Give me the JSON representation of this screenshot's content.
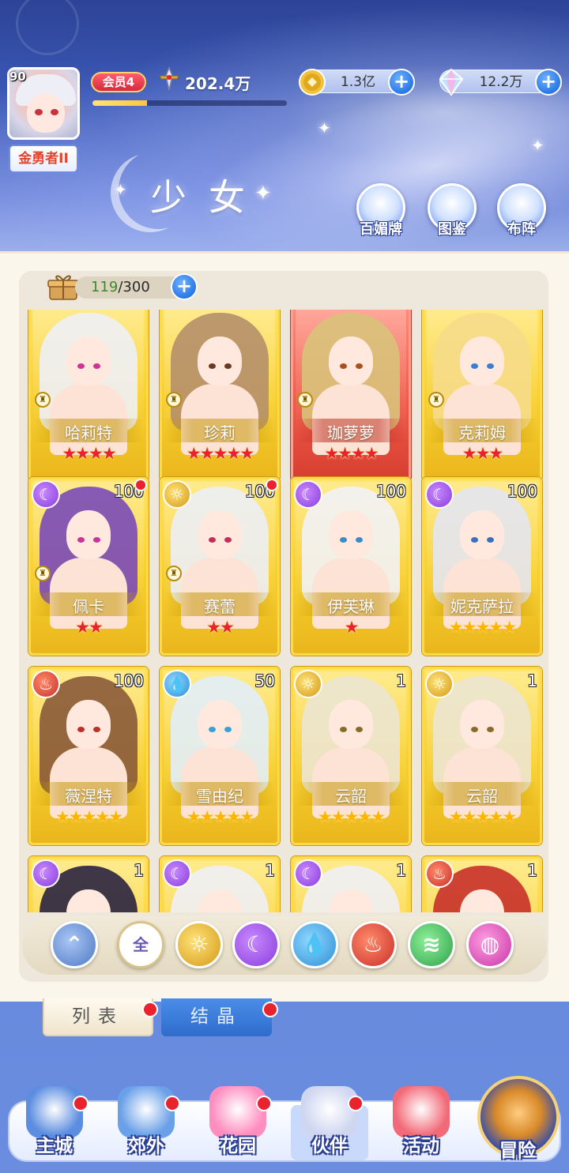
{
  "player": {
    "level": "90",
    "title": "金勇者II",
    "vip": "会员4",
    "power": "202.4万",
    "exp_progress": 0.28
  },
  "currencies": [
    {
      "name": "gold",
      "value": "1.3亿"
    },
    {
      "name": "crystal",
      "value": "12.2万"
    }
  ],
  "page_title": "少女",
  "top_buttons": [
    {
      "label": "百媚牌",
      "icon": "card-icon"
    },
    {
      "label": "图鉴",
      "icon": "book-icon"
    },
    {
      "label": "布阵",
      "icon": "grid-icon"
    }
  ],
  "bag": {
    "current": "119",
    "max": "/300"
  },
  "cards": [
    {
      "name": "哈莉特",
      "stars": 4,
      "star_color": "red",
      "frame": "gold",
      "element": "",
      "level": "",
      "dot": false,
      "hair": "#eef0f6",
      "eye": "#d0348e",
      "role": true
    },
    {
      "name": "珍莉",
      "stars": 5,
      "star_color": "red",
      "frame": "gold",
      "element": "",
      "level": "",
      "dot": false,
      "hair": "#b58f6a",
      "eye": "#6a3a20",
      "role": true
    },
    {
      "name": "珈萝萝",
      "stars": 4,
      "star_color": "red",
      "frame": "red",
      "element": "",
      "level": "",
      "dot": false,
      "hair": "#d9c27a",
      "eye": "#a8501e",
      "role": true
    },
    {
      "name": "克莉姆",
      "stars": 3,
      "star_color": "red",
      "frame": "gold",
      "element": "",
      "level": "",
      "dot": false,
      "hair": "#f6dc8a",
      "eye": "#3a7fd0",
      "role": true
    },
    {
      "name": "佩卡",
      "stars": 2,
      "star_color": "red",
      "frame": "gold",
      "element": "moon",
      "level": "100",
      "dot": true,
      "hair": "#7a4ab8",
      "eye": "#c9349a",
      "role": true
    },
    {
      "name": "赛蕾",
      "stars": 2,
      "star_color": "red",
      "frame": "gold",
      "element": "sun",
      "level": "100",
      "dot": true,
      "hair": "#eceef6",
      "eye": "#c2305a",
      "role": true
    },
    {
      "name": "伊芙琳",
      "stars": 1,
      "star_color": "red",
      "frame": "gold",
      "element": "moon",
      "level": "100",
      "dot": false,
      "hair": "#f2f2f6",
      "eye": "#3a8ac8",
      "role": false
    },
    {
      "name": "妮克萨拉",
      "stars": 5,
      "star_color": "gold",
      "frame": "gold",
      "element": "moon",
      "level": "100",
      "dot": false,
      "hair": "#e4e6f2",
      "eye": "#3a6fc0",
      "role": false
    },
    {
      "name": "薇涅特",
      "stars": 5,
      "star_color": "gold",
      "frame": "gold",
      "element": "fire",
      "level": "100",
      "dot": false,
      "hair": "#8a5a3a",
      "eye": "#c0302a",
      "role": false
    },
    {
      "name": "雪由纪",
      "stars": 5,
      "star_color": "gold",
      "frame": "gold",
      "element": "water",
      "level": "50",
      "dot": false,
      "hair": "#e2eefa",
      "eye": "#3aa0d8",
      "role": false
    },
    {
      "name": "云韶",
      "stars": 5,
      "star_color": "gold",
      "frame": "gold",
      "element": "sun",
      "level": "1",
      "dot": false,
      "hair": "#ece6d2",
      "eye": "#8a6a2a",
      "role": false
    },
    {
      "name": "云韶",
      "stars": 5,
      "star_color": "gold",
      "frame": "gold",
      "element": "sun",
      "level": "1",
      "dot": false,
      "hair": "#ece6d2",
      "eye": "#8a6a2a",
      "role": false
    },
    {
      "name": "",
      "stars": 0,
      "star_color": "gold",
      "frame": "gold",
      "element": "moon",
      "level": "1",
      "dot": false,
      "hair": "#2a2440",
      "eye": "#6a3a8a",
      "role": false
    },
    {
      "name": "",
      "stars": 0,
      "star_color": "gold",
      "frame": "gold",
      "element": "moon",
      "level": "1",
      "dot": false,
      "hair": "#f0f0f6",
      "eye": "#3a8ac8",
      "role": false
    },
    {
      "name": "",
      "stars": 0,
      "star_color": "gold",
      "frame": "gold",
      "element": "moon",
      "level": "1",
      "dot": false,
      "hair": "#f0f0f6",
      "eye": "#3a8ac8",
      "role": false
    },
    {
      "name": "",
      "stars": 0,
      "star_color": "gold",
      "frame": "gold",
      "element": "fire",
      "level": "1",
      "dot": false,
      "hair": "#c8302a",
      "eye": "#c0302a",
      "role": false
    }
  ],
  "filters": [
    {
      "id": "sort",
      "label": ""
    },
    {
      "id": "all",
      "label": "全"
    },
    {
      "id": "sun",
      "label": "☼"
    },
    {
      "id": "moon",
      "label": "☾"
    },
    {
      "id": "water",
      "label": "💧"
    },
    {
      "id": "fire",
      "label": "♨"
    },
    {
      "id": "wind",
      "label": "≋"
    },
    {
      "id": "orb",
      "label": "◍"
    }
  ],
  "tabs": [
    {
      "label": "列表",
      "active": true
    },
    {
      "label": "结晶",
      "active": false
    }
  ],
  "nav": [
    {
      "label": "主城",
      "dot": true
    },
    {
      "label": "郊外",
      "dot": true
    },
    {
      "label": "花园",
      "dot": true
    },
    {
      "label": "伙伴",
      "dot": true,
      "active": true
    },
    {
      "label": "活动",
      "dot": false
    },
    {
      "label": "冒险",
      "dot": false
    }
  ],
  "colors": {
    "star_red": "#e8232e",
    "star_gold": "#ffb400",
    "frame_gold": "#f7cf2d",
    "frame_red": "#f05a48",
    "accent_blue": "#2a78e6",
    "badge_dot": "#e8232e"
  }
}
